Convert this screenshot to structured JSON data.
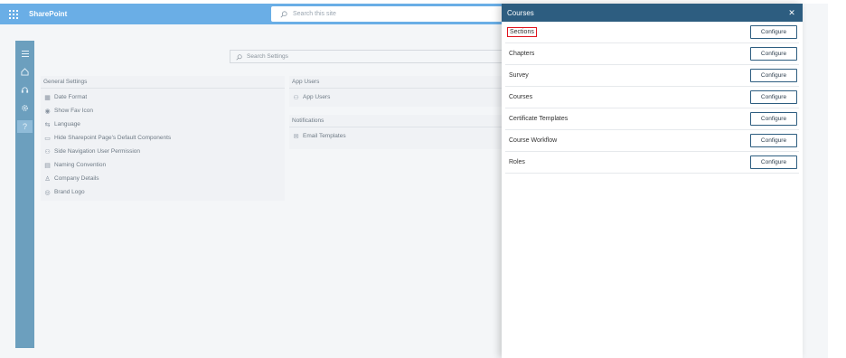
{
  "suitebar": {
    "brand": "SharePoint",
    "search_placeholder": "Search this site"
  },
  "left_rail": {
    "icons": [
      "menu-icon",
      "home-icon",
      "headset-icon",
      "settings-icon",
      "help-icon"
    ]
  },
  "settings": {
    "search_placeholder": "Search Settings",
    "general": {
      "heading": "General Settings",
      "items": [
        {
          "label": "Date Format",
          "icon": "calendar-icon"
        },
        {
          "label": "Show Fav Icon",
          "icon": "eye-icon"
        },
        {
          "label": "Language",
          "icon": "language-icon"
        },
        {
          "label": "Hide Sharepoint Page's Default Components",
          "icon": "window-icon"
        },
        {
          "label": "Side Navigation User Permission",
          "icon": "users-icon"
        },
        {
          "label": "Naming Convention",
          "icon": "tag-icon"
        },
        {
          "label": "Company Details",
          "icon": "company-icon"
        },
        {
          "label": "Brand Logo",
          "icon": "logo-icon"
        }
      ]
    },
    "app_users": {
      "heading": "App Users",
      "items": [
        {
          "label": "App Users",
          "icon": "users-icon"
        }
      ]
    },
    "notifications": {
      "heading": "Notifications",
      "items": [
        {
          "label": "Email Templates",
          "icon": "email-icon"
        }
      ]
    }
  },
  "panel": {
    "title": "Courses",
    "close_label": "✕",
    "button_label": "Configure",
    "rows": [
      {
        "label": "Sections",
        "highlighted": true
      },
      {
        "label": "Chapters"
      },
      {
        "label": "Survey"
      },
      {
        "label": "Courses"
      },
      {
        "label": "Certificate Templates"
      },
      {
        "label": "Course Workflow"
      },
      {
        "label": "Roles"
      }
    ]
  },
  "colors": {
    "suitebar": "#6aaee6",
    "panel_header": "#2d5d80",
    "highlight": "#e0141e",
    "rail": "#6c9fbe"
  }
}
